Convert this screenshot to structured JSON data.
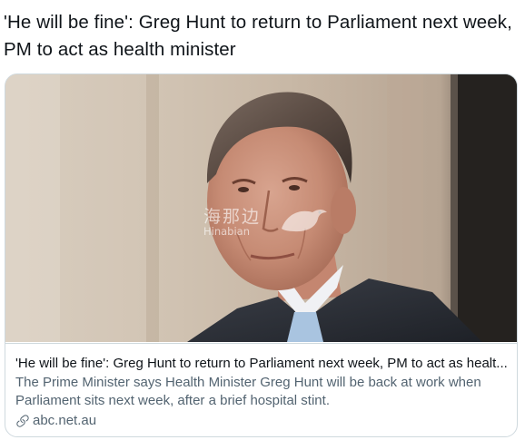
{
  "tweet": {
    "text": "'He will be fine': Greg Hunt to return to Parliament next week, PM to act as health minister"
  },
  "card": {
    "image": {
      "description_icon": "news-photo",
      "watermark_cn": "海那边",
      "watermark_en": "Hinabian"
    },
    "title": "'He will be fine': Greg Hunt to return to Parliament next week, PM to act as healt...",
    "description": "The Prime Minister says Health Minister Greg Hunt will be back at work when Parliament sits next week, after a brief hospital stint.",
    "domain": "abc.net.au",
    "domain_icon": "link-icon"
  },
  "colors": {
    "text_primary": "#0f1419",
    "text_secondary": "#536471",
    "border": "#cfd9de"
  }
}
